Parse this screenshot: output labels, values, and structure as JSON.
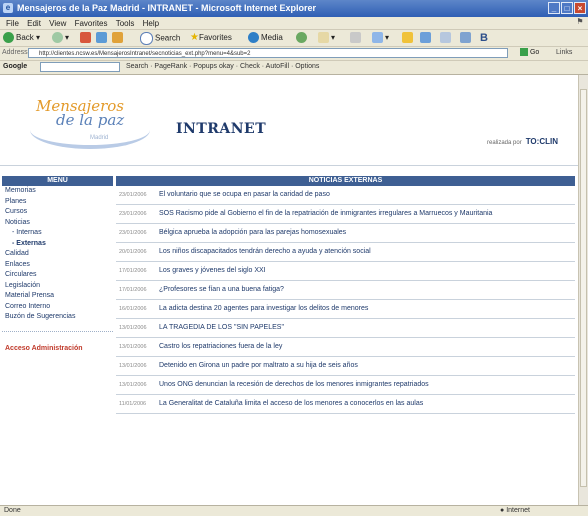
{
  "window": {
    "title": "Mensajeros de la Paz Madrid - INTRANET - Microsoft Internet Explorer",
    "buttons": [
      "_",
      "□",
      "×"
    ]
  },
  "menubar": [
    "File",
    "Edit",
    "View",
    "Favorites",
    "Tools",
    "Help"
  ],
  "toolbar": {
    "back": "Back",
    "search": "Search",
    "favorites": "Favorites",
    "media": "Media"
  },
  "address": {
    "label": "Address",
    "url": "http://clientes.ncsw.es/MensajerosIntranet/secnoticias_ext.php?menu=4&sub=2",
    "go": "Go",
    "links": "Links"
  },
  "googlebar": {
    "brand": "Google",
    "items": "Search  ·  PageRank  ·  Popups okay  ·  Check  ·  AutoFill  ·  Options"
  },
  "status": {
    "left": "Done",
    "zone": "Internet"
  },
  "site": {
    "logo_line1": "Mensajeros",
    "logo_line2": "de la paz",
    "logo_tag": "Madrid",
    "section_title": "INTRANET",
    "brand_prefix": "realizada por",
    "brand_name": "TO:CLIN"
  },
  "nav": {
    "header": "MENÚ",
    "items": [
      {
        "label": "Memorias",
        "sub": false,
        "active": false
      },
      {
        "label": "Planes",
        "sub": false,
        "active": false
      },
      {
        "label": "Cursos",
        "sub": false,
        "active": false
      },
      {
        "label": "Noticias",
        "sub": false,
        "active": false
      },
      {
        "label": "- Internas",
        "sub": true,
        "active": false
      },
      {
        "label": "- Externas",
        "sub": true,
        "active": true
      },
      {
        "label": "Calidad",
        "sub": false,
        "active": false
      },
      {
        "label": "Enlaces",
        "sub": false,
        "active": false
      },
      {
        "label": "Circulares",
        "sub": false,
        "active": false
      },
      {
        "label": "Legislación",
        "sub": false,
        "active": false
      },
      {
        "label": "Material Prensa",
        "sub": false,
        "active": false
      },
      {
        "label": "Correo Interno",
        "sub": false,
        "active": false
      },
      {
        "label": "Buzón de Sugerencias",
        "sub": false,
        "active": false
      }
    ],
    "admin_label": "Acceso Administración"
  },
  "news": {
    "header": "NOTICIAS EXTERNAS",
    "rows": [
      {
        "date": "23/01/2006",
        "title": "El voluntario que se ocupa en pasar la caridad de paso"
      },
      {
        "date": "23/01/2006",
        "title": "SOS Racismo pide al Gobierno el fin de la repatriación de inmigrantes irregulares a Marruecos y Mauritania"
      },
      {
        "date": "23/01/2006",
        "title": "Bélgica aprueba la adopción para las parejas homosexuales"
      },
      {
        "date": "20/01/2006",
        "title": "Los niños discapacitados tendrán derecho a ayuda y atención social"
      },
      {
        "date": "17/01/2006",
        "title": "Los graves y jóvenes del siglo XXI"
      },
      {
        "date": "17/01/2006",
        "title": "¿Profesores se fían a una buena fatiga?"
      },
      {
        "date": "16/01/2006",
        "title": "La adicta destina 20 agentes para investigar los delitos de menores"
      },
      {
        "date": "13/01/2006",
        "title": "LA TRAGEDIA DE LOS \"SIN PAPELES\""
      },
      {
        "date": "13/01/2006",
        "title": "Castro los repatriaciones fuera de la ley"
      },
      {
        "date": "13/01/2006",
        "title": "Detenido en Girona un padre por maltrato a su hija de seis años"
      },
      {
        "date": "13/01/2006",
        "title": "Unos ONG denuncian la recesión de derechos de los menores inmigrantes repatriados"
      },
      {
        "date": "11/01/2006",
        "title": "La Generalitat de Cataluña limita el acceso de los menores a conocerlos en las aulas"
      }
    ]
  },
  "colors": {
    "nav_header_bg": "#3e5f93",
    "link": "#1f3a6b",
    "admin_link": "#c03a2b",
    "titlebar": "#2f5fb4"
  }
}
